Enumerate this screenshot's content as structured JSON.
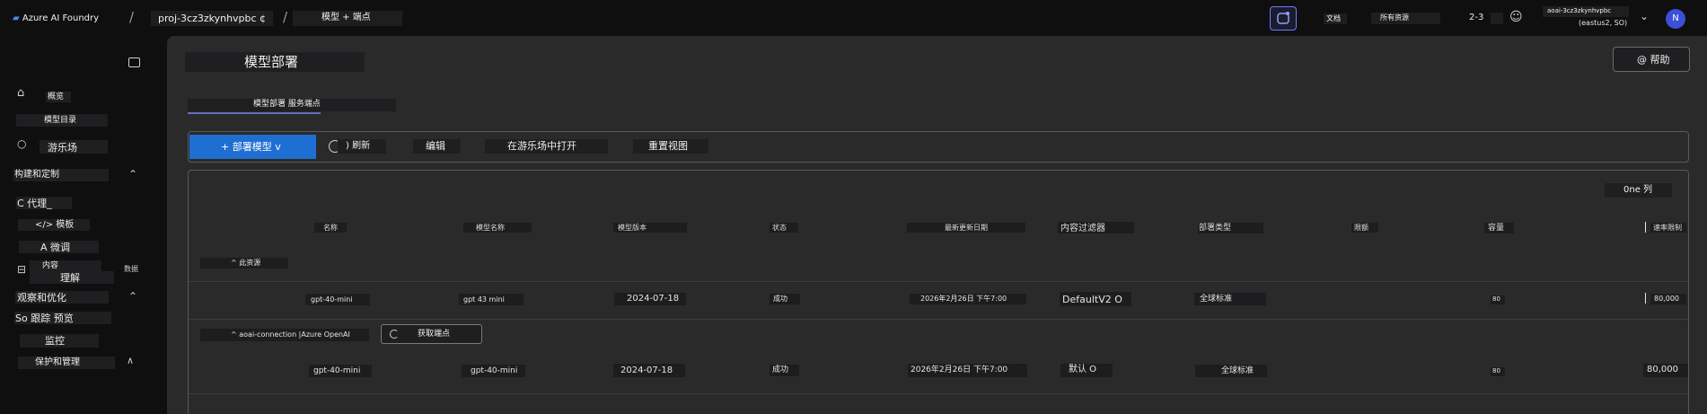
{
  "topbar": {
    "app_name": "Azure AI Foundry",
    "sep1": "/",
    "project": "proj-3cz3zkynhvpbc ¢",
    "sep2": "/",
    "section": "模型 + 端点",
    "docs": "文档",
    "all_resources": "所有资源",
    "count": "2-3",
    "account_line1": "aoai-3cz3zkynhvpbc",
    "account_line2": "(eastus2, SO)",
    "avatar": "N"
  },
  "sidebar": {
    "overview": "概览",
    "model_catalog": "模型目录",
    "playground": "游乐场",
    "build_section": "构建和定制",
    "agents": "C 代理_",
    "templates": "</> 模板",
    "finetune": "A 微调",
    "content": "内容",
    "understand": "理解",
    "tag_data": "数据",
    "observe_section": "观察和优化",
    "tracing": "So 跟踪 预览",
    "monitor": "监控",
    "protect": "保护和管理"
  },
  "main": {
    "page_title": "模型部署",
    "help_label": "@ 帮助",
    "tabs": "模型部署 服务端点",
    "toolbar": {
      "deploy": "+ 部署模型 v",
      "refresh": ") 刷新",
      "edit": "编辑",
      "open_playground": "在游乐场中打开",
      "reset_view": "重置视图"
    },
    "columns_button": "0ne 列",
    "headers": [
      "名称",
      "模型名称",
      "模型版本",
      "状态",
      "最新更新日期",
      "内容过滤器",
      "部署类型",
      "限额",
      "容量",
      "速率限制"
    ],
    "group1_label": "^ 此资源",
    "rows": [
      {
        "name": "gpt-40-mini",
        "model": "gpt 43 mini",
        "version": "2024-07-18",
        "state": "成功",
        "updated": "2026年2月26日 下午7:00",
        "filter": "DefaultV2 O",
        "type": "全球标准",
        "capacity": "80",
        "rate": "80,000"
      },
      {
        "name": "gpt-40-mini",
        "model": "gpt-40-mini",
        "version": "2024-07-18",
        "state": "成功",
        "updated": "2026年2月26日 下午7:00",
        "filter": "默认 O",
        "type": "全球标准",
        "capacity": "80",
        "rate": "80,000"
      }
    ],
    "group2_label": "^ aoai-connection |Azure OpenAI",
    "get_endpoint": "获取端点"
  }
}
